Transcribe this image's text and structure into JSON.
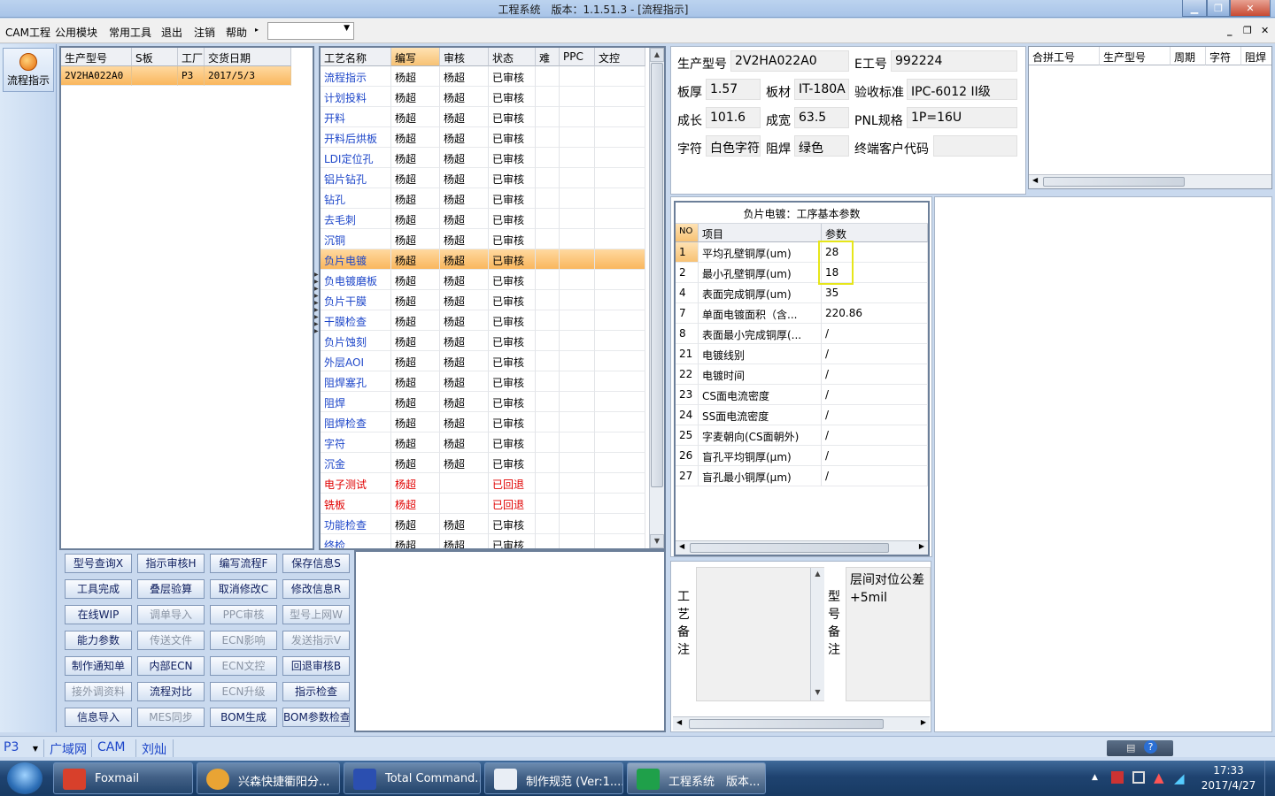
{
  "window": {
    "title": "工程系统　版本：1.1.51.3 - [流程指示]"
  },
  "menu": {
    "items": [
      "CAM工程",
      "公用模块",
      "常用工具",
      "退出",
      "注销",
      "帮助"
    ],
    "help_arrow": "▸",
    "combo_value": ""
  },
  "leftnav": {
    "button_label": "流程指示"
  },
  "order_grid": {
    "columns": [
      "生产型号",
      "S板",
      "工厂",
      "交货日期"
    ],
    "rows": [
      [
        "2V2HA022A0",
        "",
        "P3",
        "2017/5/3"
      ]
    ]
  },
  "process_grid": {
    "columns": [
      "工艺名称",
      "编写",
      "审核",
      "状态",
      "难",
      "PPC",
      "文控"
    ],
    "rows": [
      {
        "name": "流程指示",
        "writer": "杨超",
        "reviewer": "杨超",
        "status": "已审核"
      },
      {
        "name": "计划投料",
        "writer": "杨超",
        "reviewer": "杨超",
        "status": "已审核"
      },
      {
        "name": "开料",
        "writer": "杨超",
        "reviewer": "杨超",
        "status": "已审核"
      },
      {
        "name": "开料后烘板",
        "writer": "杨超",
        "reviewer": "杨超",
        "status": "已审核"
      },
      {
        "name": "LDI定位孔",
        "writer": "杨超",
        "reviewer": "杨超",
        "status": "已审核"
      },
      {
        "name": "铝片钻孔",
        "writer": "杨超",
        "reviewer": "杨超",
        "status": "已审核"
      },
      {
        "name": "钻孔",
        "writer": "杨超",
        "reviewer": "杨超",
        "status": "已审核"
      },
      {
        "name": "去毛刺",
        "writer": "杨超",
        "reviewer": "杨超",
        "status": "已审核"
      },
      {
        "name": "沉铜",
        "writer": "杨超",
        "reviewer": "杨超",
        "status": "已审核"
      },
      {
        "name": "负片电镀",
        "writer": "杨超",
        "reviewer": "杨超",
        "status": "已审核",
        "selected": true
      },
      {
        "name": "负电镀磨板",
        "writer": "杨超",
        "reviewer": "杨超",
        "status": "已审核"
      },
      {
        "name": "负片干膜",
        "writer": "杨超",
        "reviewer": "杨超",
        "status": "已审核"
      },
      {
        "name": "干膜检查",
        "writer": "杨超",
        "reviewer": "杨超",
        "status": "已审核"
      },
      {
        "name": "负片蚀刻",
        "writer": "杨超",
        "reviewer": "杨超",
        "status": "已审核"
      },
      {
        "name": "外层AOI",
        "writer": "杨超",
        "reviewer": "杨超",
        "status": "已审核"
      },
      {
        "name": "阻焊塞孔",
        "writer": "杨超",
        "reviewer": "杨超",
        "status": "已审核"
      },
      {
        "name": "阻焊",
        "writer": "杨超",
        "reviewer": "杨超",
        "status": "已审核"
      },
      {
        "name": "阻焊检查",
        "writer": "杨超",
        "reviewer": "杨超",
        "status": "已审核"
      },
      {
        "name": "字符",
        "writer": "杨超",
        "reviewer": "杨超",
        "status": "已审核"
      },
      {
        "name": "沉金",
        "writer": "杨超",
        "reviewer": "杨超",
        "status": "已审核"
      },
      {
        "name": "电子测试",
        "writer": "杨超",
        "reviewer": "",
        "status": "已回退",
        "returned": true
      },
      {
        "name": "铣板",
        "writer": "杨超",
        "reviewer": "",
        "status": "已回退",
        "returned": true
      },
      {
        "name": "功能检查",
        "writer": "杨超",
        "reviewer": "杨超",
        "status": "已审核"
      },
      {
        "name": "终检",
        "writer": "杨超",
        "reviewer": "杨超",
        "status": "已审核"
      }
    ]
  },
  "buttons": [
    [
      {
        "label": "型号查询X",
        "enabled": true
      },
      {
        "label": "指示审核H",
        "enabled": true
      },
      {
        "label": "编写流程F",
        "enabled": true
      },
      {
        "label": "保存信息S",
        "enabled": true
      }
    ],
    [
      {
        "label": "工具完成",
        "enabled": true
      },
      {
        "label": "叠层验算",
        "enabled": true
      },
      {
        "label": "取消修改C",
        "enabled": true
      },
      {
        "label": "修改信息R",
        "enabled": true
      }
    ],
    [
      {
        "label": "在线WIP",
        "enabled": true
      },
      {
        "label": "调单导入",
        "enabled": false
      },
      {
        "label": "PPC审核",
        "enabled": false
      },
      {
        "label": "型号上网W",
        "enabled": false
      }
    ],
    [
      {
        "label": "能力参数",
        "enabled": true
      },
      {
        "label": "传送文件",
        "enabled": false
      },
      {
        "label": "ECN影响",
        "enabled": false
      },
      {
        "label": "发送指示V",
        "enabled": false
      }
    ],
    [
      {
        "label": "制作通知单",
        "enabled": true
      },
      {
        "label": "内部ECN",
        "enabled": true
      },
      {
        "label": "ECN文控",
        "enabled": false
      },
      {
        "label": "回退审核B",
        "enabled": true
      }
    ],
    [
      {
        "label": "接外调资料",
        "enabled": false
      },
      {
        "label": "流程对比",
        "enabled": true
      },
      {
        "label": "ECN升级",
        "enabled": false
      },
      {
        "label": "指示检查",
        "enabled": true
      }
    ],
    [
      {
        "label": "信息导入",
        "enabled": true
      },
      {
        "label": "MES同步",
        "enabled": false
      },
      {
        "label": "BOM生成",
        "enabled": true
      },
      {
        "label": "BOM参数检查",
        "enabled": true
      }
    ]
  ],
  "info": {
    "model_label": "生产型号",
    "model_value": "2V2HA022A0",
    "e_label": "E工号",
    "e_value": "992224",
    "thick_label": "板厚",
    "thick_value": "1.57",
    "material_label": "板材",
    "material_value": "IT-180A",
    "accept_label": "验收标准",
    "accept_value": "IPC-6012 II级",
    "len_label": "成长",
    "len_value": "101.6",
    "width_label": "成宽",
    "width_value": "63.5",
    "pnl_label": "PNL规格",
    "pnl_value": "1P=16U",
    "char_label": "字符",
    "char_value": "白色字符",
    "mask_label": "阻焊",
    "mask_value": "绿色",
    "customer_label": "终端客户代码",
    "customer_value": ""
  },
  "merge_grid": {
    "columns": [
      "合拼工号",
      "生产型号",
      "周期",
      "字符",
      "阻焊"
    ]
  },
  "param_panel": {
    "title": "负片电镀：工序基本参数",
    "columns": [
      "NO",
      "项目",
      "参数"
    ],
    "rows": [
      {
        "no": "1",
        "item": "平均孔壁铜厚(um)",
        "value": "28"
      },
      {
        "no": "2",
        "item": "最小孔壁铜厚(um)",
        "value": "18"
      },
      {
        "no": "4",
        "item": "表面完成铜厚(um)",
        "value": "35"
      },
      {
        "no": "7",
        "item": "单面电镀面积（含...",
        "value": "220.86"
      },
      {
        "no": "8",
        "item": "表面最小完成铜厚(...",
        "value": "/"
      },
      {
        "no": "21",
        "item": "电镀线别",
        "value": "/"
      },
      {
        "no": "22",
        "item": "电镀时间",
        "value": "/"
      },
      {
        "no": "23",
        "item": "CS面电流密度",
        "value": "/"
      },
      {
        "no": "24",
        "item": "SS面电流密度",
        "value": "/"
      },
      {
        "no": "25",
        "item": "字麦朝向(CS面朝外)",
        "value": "/"
      },
      {
        "no": "26",
        "item": "盲孔平均铜厚(μm)",
        "value": "/"
      },
      {
        "no": "27",
        "item": "盲孔最小铜厚(μm)",
        "value": "/"
      }
    ]
  },
  "remarks": {
    "process_label": "工艺备注",
    "model_label": "型号备注",
    "model_text": "层间对位公差+5mil"
  },
  "statusbar": {
    "items": [
      "P3",
      "广域网",
      "CAM",
      "刘灿"
    ]
  },
  "taskbar": {
    "tasks": [
      "Foxmail",
      "兴森快捷衢阳分...",
      "Total Command...",
      "制作规范 (Ver:1....",
      "工程系统　版本..."
    ],
    "time": "17:33",
    "date": "2017/4/27"
  },
  "colors": {
    "selection": "#f9b55a",
    "returned": "#e00000",
    "highlight_box": "#e6e61a"
  }
}
